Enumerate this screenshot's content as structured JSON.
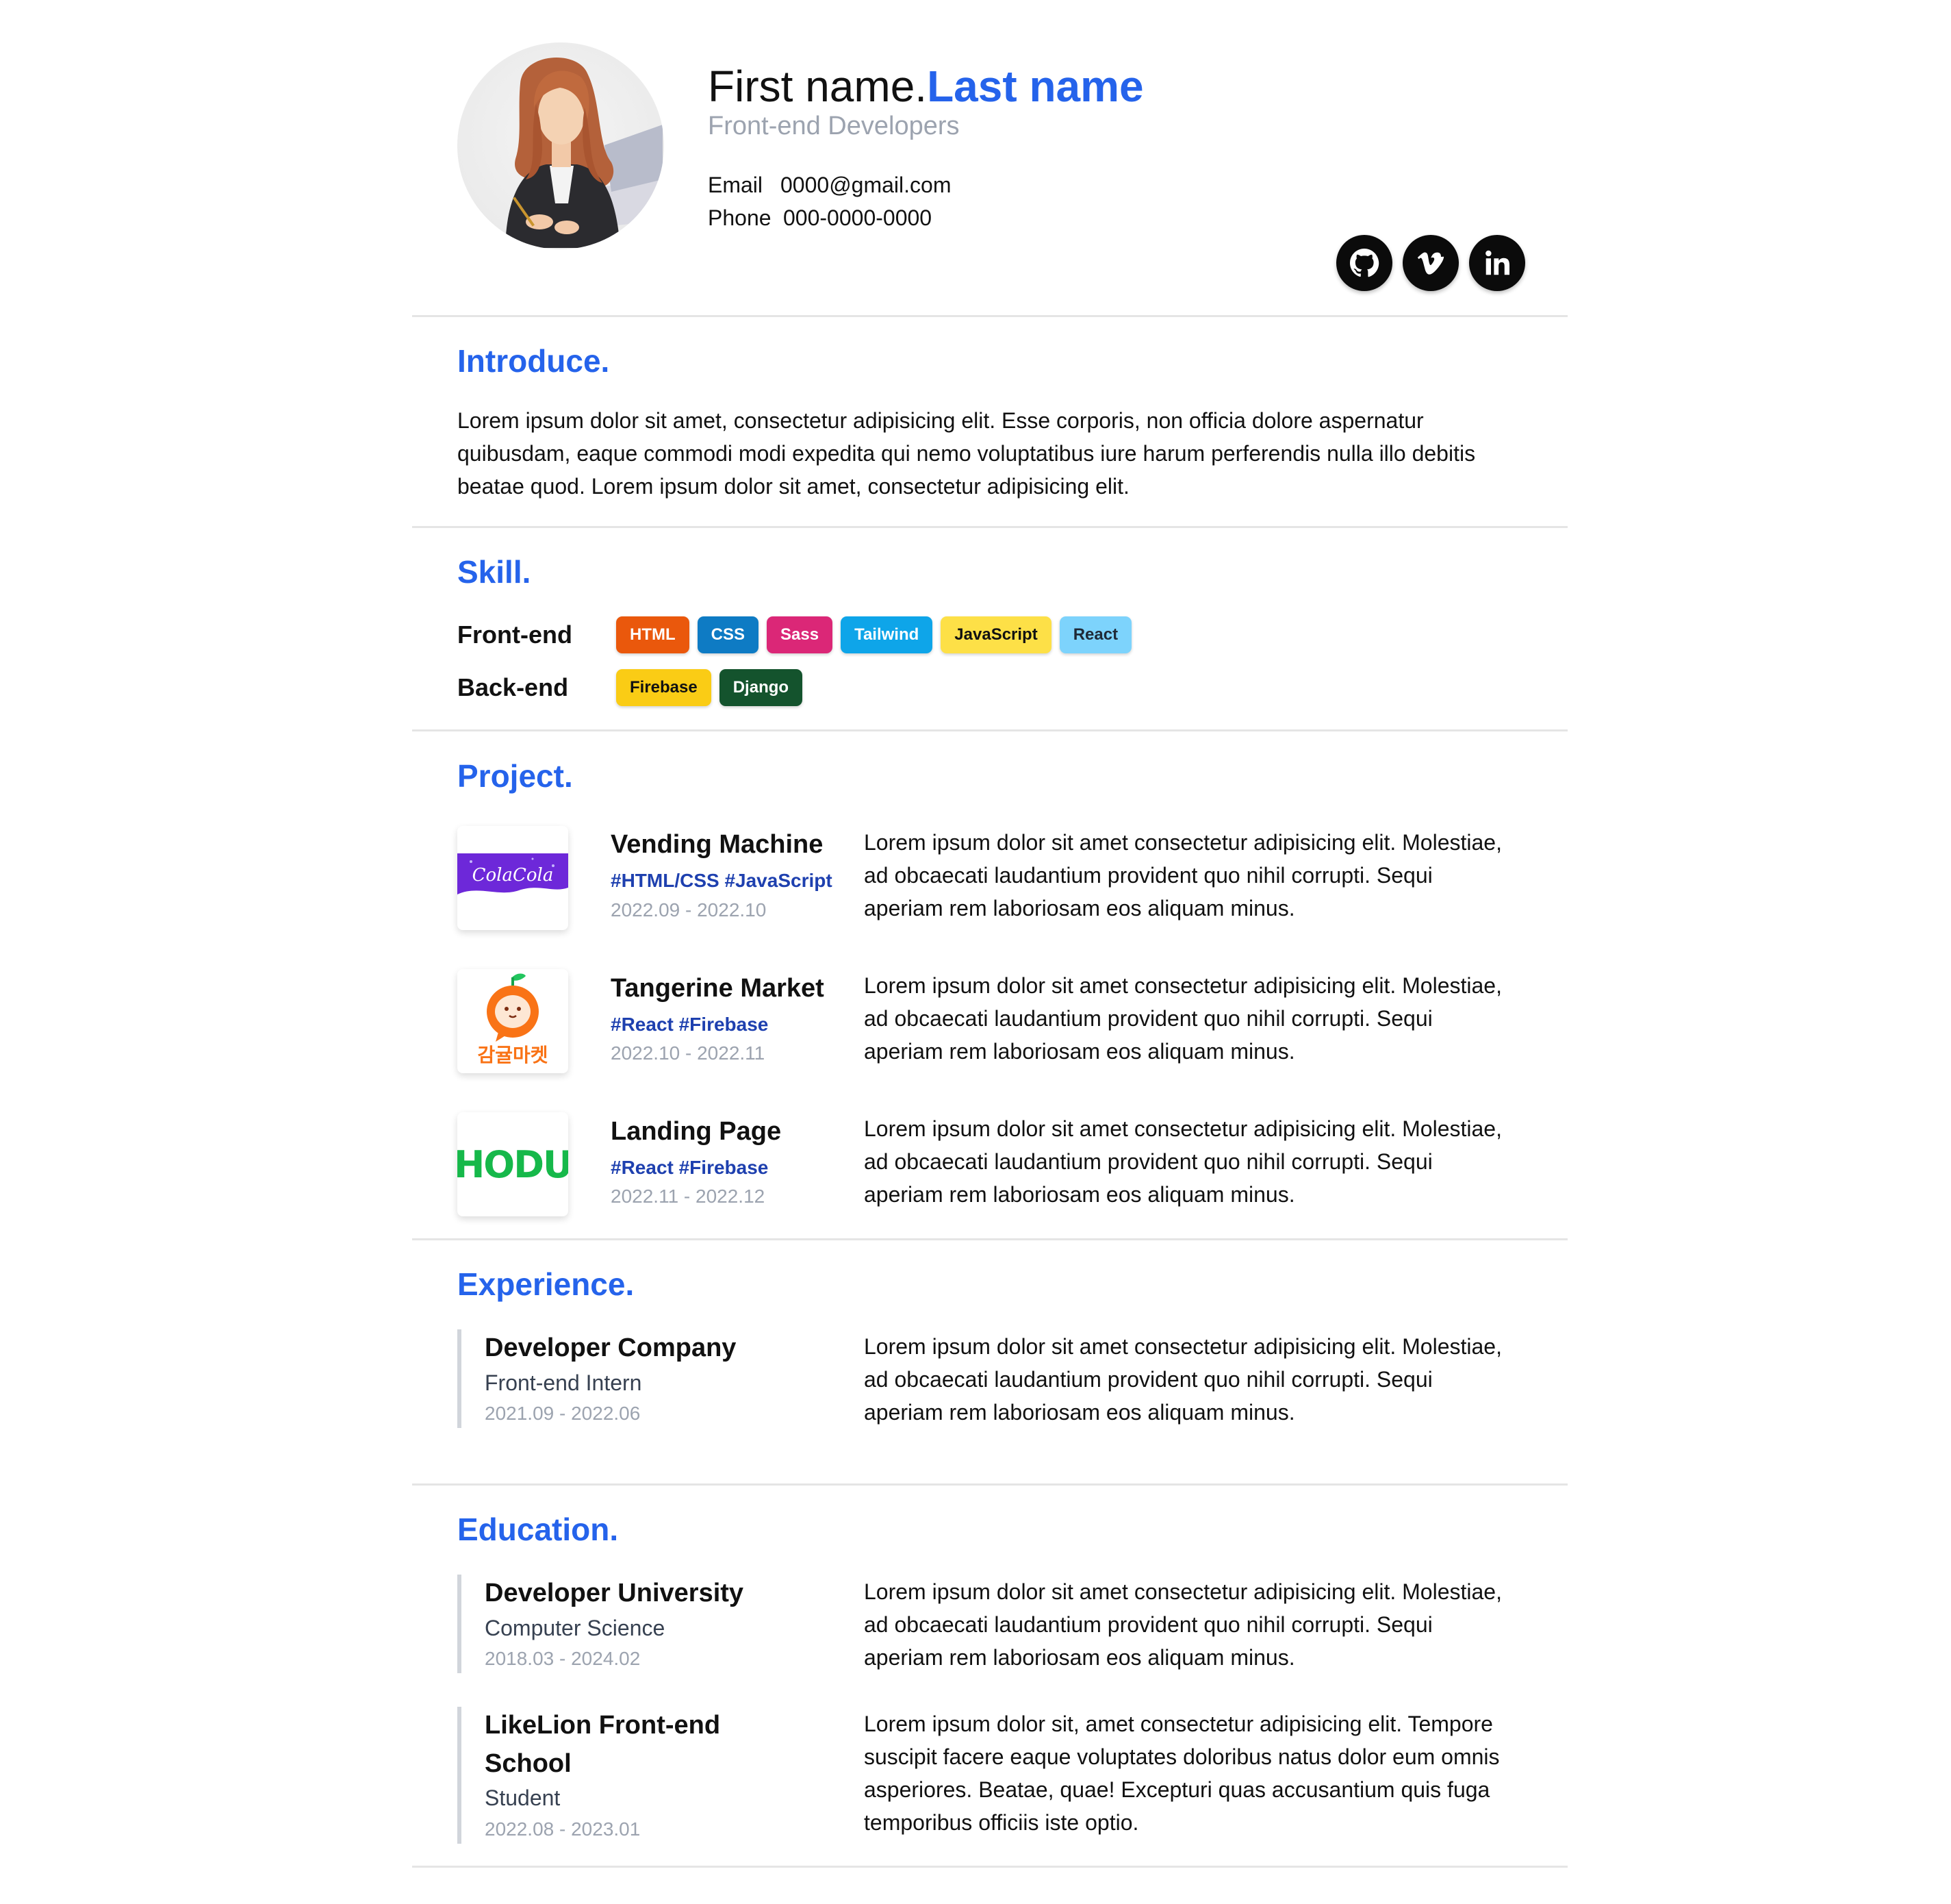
{
  "header": {
    "first_name": "First name.",
    "last_name": "Last name",
    "job_title": "Front-end Developers",
    "email_label": "Email",
    "email_value": "0000@gmail.com",
    "phone_label": "Phone",
    "phone_value": "000-0000-0000",
    "social_icons": [
      "github-icon",
      "vimeo-icon",
      "linkedin-icon"
    ]
  },
  "introduce": {
    "title": "Introduce.",
    "lines": [
      "Lorem ipsum dolor sit amet, consectetur adipisicing elit. Esse corporis, non officia dolore aspernatur",
      "quibusdam, eaque commodi modi expedita qui nemo voluptatibus iure harum perferendis nulla illo debitis",
      "beatae quod. Lorem ipsum dolor sit amet, consectetur adipisicing elit."
    ]
  },
  "skill": {
    "title": "Skill.",
    "frontend_label": "Front-end",
    "frontend": [
      {
        "name": "HTML",
        "bg": "#ea580c",
        "fg": "#ffffff"
      },
      {
        "name": "CSS",
        "bg": "#0e7bc4",
        "fg": "#ffffff"
      },
      {
        "name": "Sass",
        "bg": "#db2777",
        "fg": "#ffffff"
      },
      {
        "name": "Tailwind",
        "bg": "#0ea5e9",
        "fg": "#ffffff"
      },
      {
        "name": "JavaScript",
        "bg": "#fde047",
        "fg": "#111111"
      },
      {
        "name": "React",
        "bg": "#7dd3fc",
        "fg": "#1f2937"
      }
    ],
    "backend_label": "Back-end",
    "backend": [
      {
        "name": "Firebase",
        "bg": "#facc15",
        "fg": "#111111"
      },
      {
        "name": "Django",
        "bg": "#14532d",
        "fg": "#ffffff"
      }
    ]
  },
  "project": {
    "title": "Project.",
    "items": [
      {
        "name": "Vending Machine",
        "tags": "#HTML/CSS #JavaScript",
        "date": "2022.09 - 2022.10",
        "thumb_text": "ColaCola",
        "lines": [
          "Lorem ipsum dolor sit amet consectetur adipisicing elit. Molestiae,",
          "ad obcaecati laudantium provident quo nihil corrupti. Sequi",
          "aperiam rem laboriosam eos aliquam minus."
        ]
      },
      {
        "name": "Tangerine Market",
        "tags": "#React #Firebase",
        "date": "2022.10 - 2022.11",
        "thumb_text": "감귤마켓",
        "lines": [
          "Lorem ipsum dolor sit amet consectetur adipisicing elit. Molestiae,",
          "ad obcaecati laudantium provident quo nihil corrupti. Sequi",
          "aperiam rem laboriosam eos aliquam minus."
        ]
      },
      {
        "name": "Landing Page",
        "tags": "#React #Firebase",
        "date": "2022.11 - 2022.12",
        "thumb_text": "HODU",
        "lines": [
          "Lorem ipsum dolor sit amet consectetur adipisicing elit. Molestiae,",
          "ad obcaecati laudantium provident quo nihil corrupti. Sequi",
          "aperiam rem laboriosam eos aliquam minus."
        ]
      }
    ]
  },
  "experience": {
    "title": "Experience.",
    "items": [
      {
        "name": "Developer Company",
        "role": "Front-end Intern",
        "date": "2021.09 - 2022.06",
        "lines": [
          "Lorem ipsum dolor sit amet consectetur adipisicing elit. Molestiae,",
          "ad obcaecati laudantium provident quo nihil corrupti. Sequi",
          "aperiam rem laboriosam eos aliquam minus."
        ]
      }
    ]
  },
  "education": {
    "title": "Education.",
    "items": [
      {
        "name": "Developer University",
        "role": "Computer Science",
        "date": "2018.03 - 2024.02",
        "lines": [
          "Lorem ipsum dolor sit amet consectetur adipisicing elit. Molestiae,",
          "ad obcaecati laudantium provident quo nihil corrupti. Sequi",
          "aperiam rem laboriosam eos aliquam minus."
        ]
      },
      {
        "name_line1": "LikeLion Front-end",
        "name_line2": "School",
        "role": "Student",
        "date": "2022.08 - 2023.01",
        "lines": [
          "Lorem ipsum dolor sit, amet consectetur adipisicing elit. Tempore",
          "suscipit facere eaque voluptates doloribus natus dolor eum omnis",
          "asperiores. Beatae, quae! Excepturi quas accusantium quis fuga",
          "temporibus officiis iste optio."
        ]
      }
    ]
  }
}
